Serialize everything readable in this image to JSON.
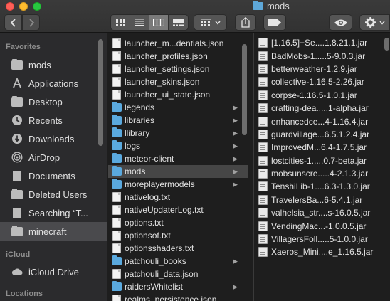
{
  "window": {
    "title": "mods"
  },
  "toolbar": {
    "back_icon": "chevron-left-icon",
    "forward_icon": "chevron-right-icon",
    "views": [
      "icon-view",
      "list-view",
      "column-view",
      "gallery-view"
    ],
    "active_view": "column-view"
  },
  "sidebar": {
    "favorites_header": "Favorites",
    "items": [
      {
        "label": "mods",
        "icon": "folder-icon"
      },
      {
        "label": "Applications",
        "icon": "applications-icon"
      },
      {
        "label": "Desktop",
        "icon": "folder-icon"
      },
      {
        "label": "Recents",
        "icon": "clock-icon"
      },
      {
        "label": "Downloads",
        "icon": "download-icon"
      },
      {
        "label": "AirDrop",
        "icon": "airdrop-icon"
      },
      {
        "label": "Documents",
        "icon": "document-icon"
      },
      {
        "label": "Deleted Users",
        "icon": "folder-icon"
      },
      {
        "label": "Searching “T...",
        "icon": "document-icon"
      },
      {
        "label": "minecraft",
        "icon": "folder-icon"
      }
    ],
    "icloud_header": "iCloud",
    "icloud_items": [
      {
        "label": "iCloud Drive",
        "icon": "cloud-icon"
      }
    ],
    "locations_header": "Locations"
  },
  "column1": {
    "items": [
      {
        "name": "launcher_m...dentials.json",
        "kind": "doc"
      },
      {
        "name": "launcher_profiles.json",
        "kind": "doc"
      },
      {
        "name": "launcher_settings.json",
        "kind": "doc"
      },
      {
        "name": "launcher_skins.json",
        "kind": "doc"
      },
      {
        "name": "launcher_ui_state.json",
        "kind": "doc"
      },
      {
        "name": "legends",
        "kind": "folder"
      },
      {
        "name": "libraries",
        "kind": "folder"
      },
      {
        "name": "llibrary",
        "kind": "folder"
      },
      {
        "name": "logs",
        "kind": "folder"
      },
      {
        "name": "meteor-client",
        "kind": "folder"
      },
      {
        "name": "mods",
        "kind": "folder"
      },
      {
        "name": "moreplayermodels",
        "kind": "folder"
      },
      {
        "name": "nativelog.txt",
        "kind": "doc"
      },
      {
        "name": "nativeUpdaterLog.txt",
        "kind": "doc"
      },
      {
        "name": "options.txt",
        "kind": "doc"
      },
      {
        "name": "optionsof.txt",
        "kind": "doc"
      },
      {
        "name": "optionsshaders.txt",
        "kind": "doc"
      },
      {
        "name": "patchouli_books",
        "kind": "folder"
      },
      {
        "name": "patchouli_data.json",
        "kind": "doc"
      },
      {
        "name": "raidersWhitelist",
        "kind": "folder"
      },
      {
        "name": "realms_persistence.json",
        "kind": "doc"
      }
    ],
    "selected": "mods"
  },
  "column2": {
    "items": [
      "[1.16.5]+Se....1.8.21.1.jar",
      "BadMobs-1.....5-9.0.3.jar",
      "betterweather-1.2.9.jar",
      "collective-1.16.5-2.26.jar",
      "corpse-1.16.5-1.0.1.jar",
      "crafting-dea.....1-alpha.jar",
      "enhancedce...4-1.16.4.jar",
      "guardvillage...6.5.1.2.4.jar",
      "ImprovedM...6.4-1.7.5.jar",
      "lostcities-1.....0.7-beta.jar",
      "mobsunscre.....4-2.1.3.jar",
      "TenshiLib-1....6.3-1.3.0.jar",
      "TravelersBa...6-5.4.1.jar",
      "valhelsia_str....s-16.0.5.jar",
      "VendingMac...-1.0.0.5.jar",
      "VillagersFoll.....5-1.0.0.jar",
      "Xaeros_Mini....e_1.16.5.jar"
    ]
  }
}
